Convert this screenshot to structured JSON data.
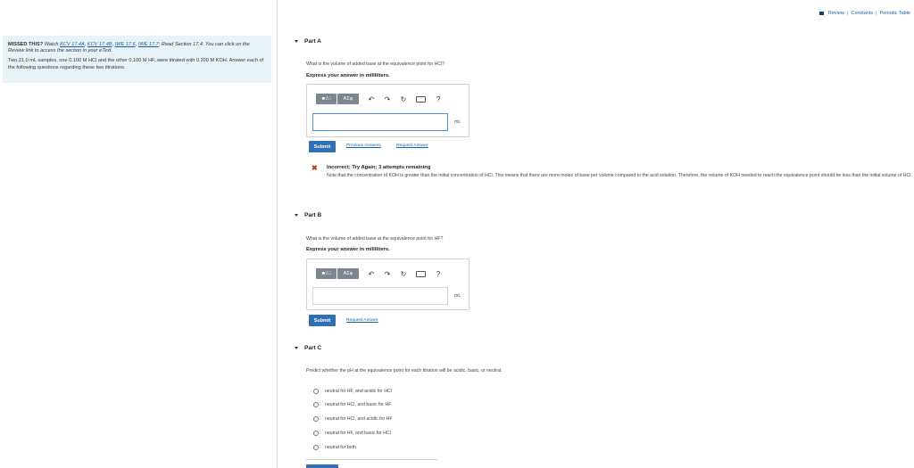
{
  "top_links": {
    "review": "Review",
    "sep": "|",
    "constants": "Constants",
    "periodic": "Periodic Table"
  },
  "missed": {
    "title": "MISSED THIS?",
    "watch": "Watch",
    "links": [
      "KCV 17.4A",
      "KCV 17.4B",
      "IWE 17.6",
      "IWE 17.7"
    ],
    "read": "Read Section 17.4. You can click on the Review link to access the section in your eText.",
    "paragraph": "Two 21.0 mL samples, one 0.100 M HCl and the other 0.100 M HF, were titrated with 0.200 M KOH. Answer each of the following questions regarding these two titrations."
  },
  "partA": {
    "label": "Part A",
    "question": "What is the volume of added base at the equivalence point for HCl?",
    "instruction": "Express your answer in milliliters.",
    "toolbar": {
      "template": "■√□",
      "greek": "AΣφ",
      "undo": "↶",
      "redo": "↷",
      "reset": "↻",
      "help": "?"
    },
    "input_value": "",
    "unit": "mL",
    "submit": "Submit",
    "previous": "Previous Answers",
    "request": "Request Answer"
  },
  "feedback": {
    "mark": "✖",
    "title": "Incorrect; Try Again; 3 attempts remaining",
    "body": "Note that the concentration of KOH is greater than the initial concentration of HCl. This means that there are more moles of base per volume compared to the acid solution. Therefore, the volume of KOH needed to reach the equivalence point should be less than the initial volume of HCl."
  },
  "partB": {
    "label": "Part B",
    "question": "What is the volume of added base at the equivalence point for HF?",
    "instruction": "Express your answer in milliliters.",
    "toolbar": {
      "template": "■√□",
      "greek": "AΣφ",
      "undo": "↶",
      "redo": "↷",
      "reset": "↻",
      "help": "?"
    },
    "input_value": "",
    "unit": "mL",
    "submit": "Submit",
    "request": "Request Answer"
  },
  "partC": {
    "label": "Part C",
    "question": "Predict whether the pH at the equivalence point for each titration will be acidic, basic, or neutral.",
    "options": [
      "neutral for HF, and acidic for HCl",
      "neutral for HCl, and basic for HF",
      "neutral for HCl, and acidic for HF",
      "neutral for HF, and basic for HCl",
      "neutral for both"
    ]
  }
}
